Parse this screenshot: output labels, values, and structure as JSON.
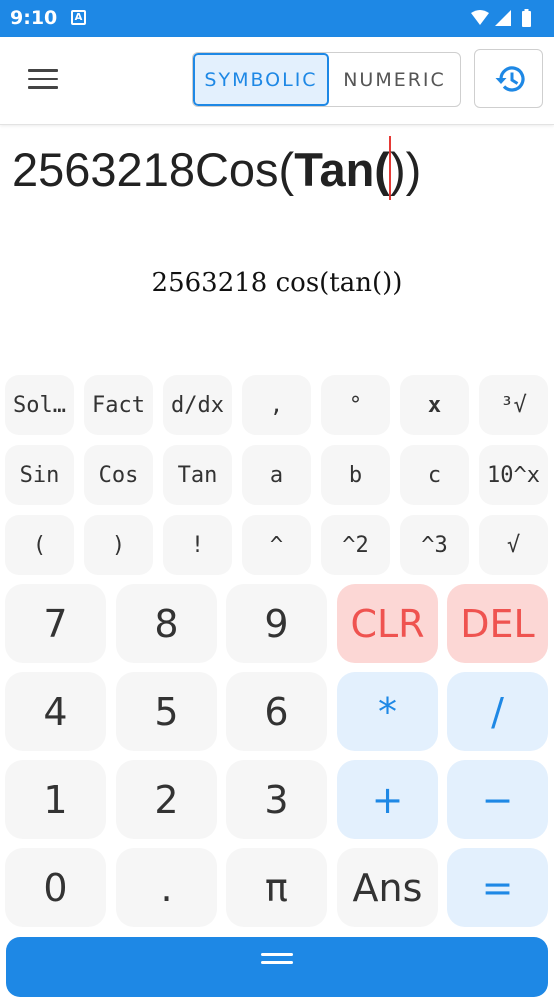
{
  "status_bar": {
    "time": "9:10",
    "notification_icon": "A",
    "icons": [
      "wifi-icon",
      "signal-icon",
      "battery-icon"
    ]
  },
  "app_bar": {
    "menu_icon": "hamburger-menu-icon",
    "modes": [
      {
        "label": "SYMBOLIC",
        "active": true
      },
      {
        "label": "NUMERIC",
        "active": false
      }
    ],
    "history_icon": "history-icon"
  },
  "expression": {
    "prefix": "2563218Cos(",
    "bold": "Tan",
    "before_cursor": "(",
    "after_cursor": "))"
  },
  "preview": "2563218 cos(tan())",
  "function_keys": {
    "row1": [
      "Sol…",
      "Fact",
      "d/dx",
      ",",
      "°",
      "x",
      "³√"
    ],
    "row2": [
      "Sin",
      "Cos",
      "Tan",
      "a",
      "b",
      "c",
      "10^x"
    ],
    "row3": [
      "(",
      ")",
      "!",
      "^",
      "^2",
      "^3",
      "√"
    ]
  },
  "number_keys": {
    "row1": [
      "7",
      "8",
      "9",
      "CLR",
      "DEL"
    ],
    "row2": [
      "4",
      "5",
      "6",
      "*",
      "/"
    ],
    "row3": [
      "1",
      "2",
      "3",
      "+",
      "−"
    ],
    "row4": [
      "0",
      ".",
      "π",
      "Ans",
      "="
    ]
  },
  "colors": {
    "accent": "#1e88e5",
    "accent_light": "#e3f0fd",
    "danger": "#ef5350",
    "danger_light": "#fcd7d5",
    "key_bg": "#f6f6f6",
    "cursor": "#e53935"
  }
}
